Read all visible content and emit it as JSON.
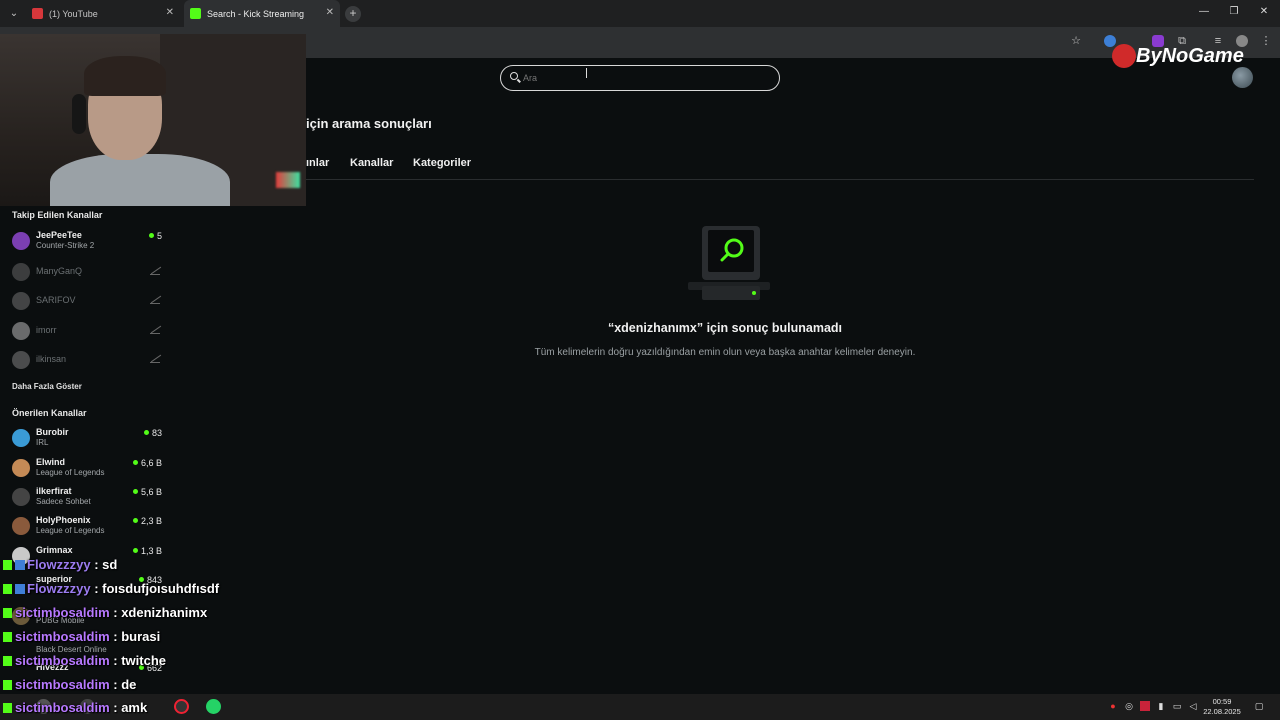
{
  "browser": {
    "tabs": [
      {
        "title": "(1) YouTube"
      },
      {
        "title": "Search - Kick Streaming"
      }
    ]
  },
  "search": {
    "placeholder": "Ara"
  },
  "results": {
    "heading": "için arama sonuçları",
    "tabs": [
      "ınlar",
      "Kanallar",
      "Kategoriler"
    ],
    "empty_title": "“xdenizhanımx” için sonuç bulunamadı",
    "empty_subtitle": "Tüm kelimelerin doğru yazıldığından emin olun veya başka anahtar kelimeler deneyin."
  },
  "brand": {
    "text": "ByNoGame"
  },
  "sidebar": {
    "followed_heading": "Takip Edilen Kanallar",
    "followed": [
      {
        "name": "JeePeeTee",
        "category": "Counter-Strike 2",
        "viewers": "5",
        "live": true
      },
      {
        "name": "ManyGanQ",
        "live": false
      },
      {
        "name": "SARIFOV",
        "live": false
      },
      {
        "name": "imorr",
        "live": false
      },
      {
        "name": "ilkinsan",
        "live": false
      }
    ],
    "show_more": "Daha Fazla Göster",
    "recommended_heading": "Önerilen Kanallar",
    "recommended": [
      {
        "name": "Burobir",
        "category": "IRL",
        "viewers": "83"
      },
      {
        "name": "Elwind",
        "category": "League of Legends",
        "viewers": "6,6 B"
      },
      {
        "name": "ilkerfirat",
        "category": "Sadece Sohbet",
        "viewers": "5,6 B"
      },
      {
        "name": "HolyPhoenix",
        "category": "League of Legends",
        "viewers": "2,3 B"
      },
      {
        "name": "Grimnax",
        "category": "",
        "viewers": "1,3 B"
      },
      {
        "name": "superior",
        "category": "",
        "viewers": "843"
      },
      {
        "name": "",
        "category": "PUBG Mobile",
        "viewers": ""
      },
      {
        "name": "",
        "category": "Black Desert Online",
        "viewers": ""
      },
      {
        "name": "Hivezzz",
        "category": "",
        "viewers": "662"
      }
    ]
  },
  "chat": [
    {
      "user": "Flowzzzyy",
      "message": ": sd"
    },
    {
      "user": "Flowzzzyy",
      "message": ": foısdufjoısuhdfısdf"
    },
    {
      "user": "sictimbosaldim",
      "message": ": xdenizhanimx"
    },
    {
      "user": "sictimbosaldim",
      "message": ": burasi"
    },
    {
      "user": "sictimbosaldim",
      "message": ": twitche"
    },
    {
      "user": "sictimbosaldim",
      "message": ": de"
    },
    {
      "user": "sictimbosaldim",
      "message": ": amk"
    }
  ],
  "taskbar": {
    "time": "00:59",
    "date": "22.08.2025"
  },
  "colors": {
    "kick_green": "#53fc18",
    "page_bg": "#0b0e0f",
    "chat_user": "#9b7cf0"
  },
  "icons": [
    "search-icon",
    "star-icon",
    "extension-icon",
    "close-icon",
    "minimize-icon",
    "maximize-icon"
  ]
}
